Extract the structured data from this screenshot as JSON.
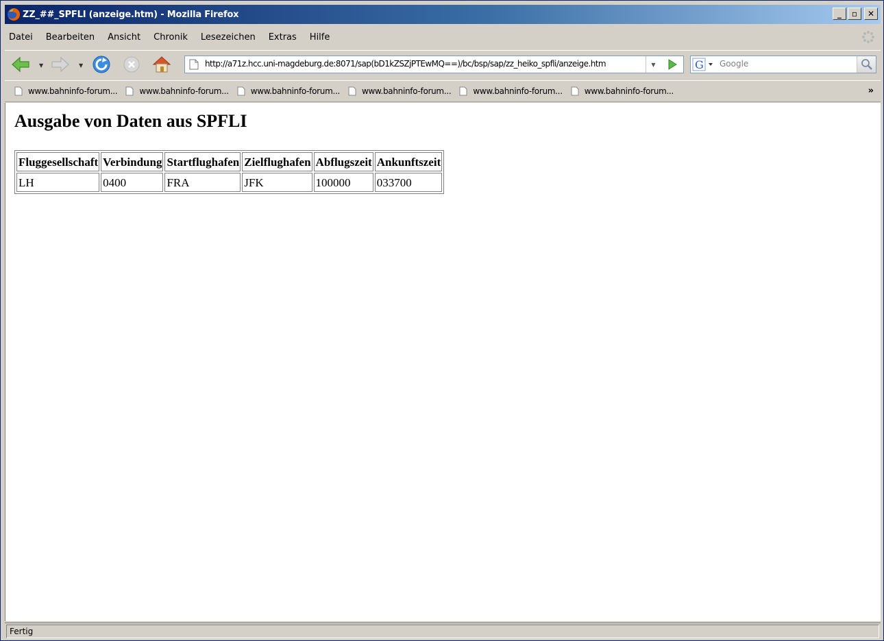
{
  "window": {
    "title": "ZZ_##_SPFLI (anzeige.htm) - Mozilla Firefox",
    "buttons": {
      "minimize": "_",
      "maximize": "▫",
      "close": "✕"
    }
  },
  "menu": {
    "items": [
      "Datei",
      "Bearbeiten",
      "Ansicht",
      "Chronik",
      "Lesezeichen",
      "Extras",
      "Hilfe"
    ]
  },
  "navigation": {
    "back_icon": "back-arrow-icon",
    "forward_icon": "forward-arrow-icon",
    "reload_icon": "reload-icon",
    "stop_icon": "stop-icon",
    "home_icon": "home-icon",
    "url": "http://a71z.hcc.uni-magdeburg.de:8071/sap(bD1kZSZjPTEwMQ==)/bc/bsp/sap/zz_heiko_spfli/anzeige.htm",
    "search_engine": "Google",
    "search_placeholder": "Google"
  },
  "bookmarks": {
    "items": [
      "www.bahninfo-forum...",
      "www.bahninfo-forum...",
      "www.bahninfo-forum...",
      "www.bahninfo-forum...",
      "www.bahninfo-forum...",
      "www.bahninfo-forum..."
    ],
    "overflow": "»"
  },
  "page": {
    "heading": "Ausgabe von Daten aus SPFLI",
    "table": {
      "headers": [
        "Fluggesellschaft",
        "Verbindung",
        "Startflughafen",
        "Zielflughafen",
        "Abflugszeit",
        "Ankunftszeit"
      ],
      "rows": [
        [
          "LH",
          "0400",
          "FRA",
          "JFK",
          "100000",
          "033700"
        ]
      ]
    }
  },
  "status": {
    "text": "Fertig"
  },
  "colors": {
    "titlebar_start": "#0a246a",
    "titlebar_end": "#a6caf0",
    "chrome": "#d4d0c8",
    "content_bg": "#ffffff"
  }
}
